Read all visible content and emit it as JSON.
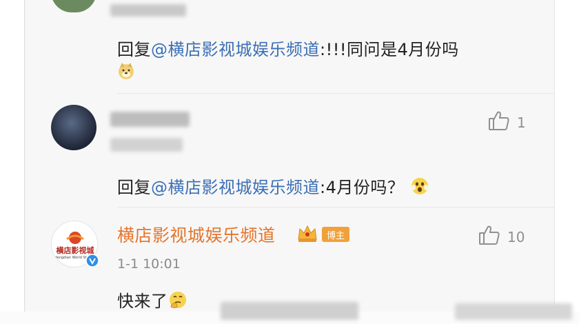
{
  "reply1": {
    "prefix": "回复",
    "mention": "@横店影视城娱乐频道",
    "suffix": ":!!!同问是4月份吗"
  },
  "comment2": {
    "like_count": "1",
    "reply_prefix": "回复",
    "reply_mention": "@横店影视城娱乐频道",
    "reply_suffix": ":4月份吗？"
  },
  "comment3": {
    "username": "横店影视城娱乐频道",
    "badge": "博主",
    "like_count": "10",
    "time": "1-1 10:01",
    "text": "快来了",
    "avatar_text": "横店影视城",
    "avatar_subtext": "Hengdian World Studios"
  },
  "icons": {
    "like": "thumbs-up-icon",
    "doge": "doge-emoji-icon",
    "shocked": "shocked-emoji-icon",
    "thinking": "thinking-emoji-icon",
    "crown": "crown-vip-icon",
    "verified": "verified-v-icon"
  },
  "colors": {
    "mention": "#3b6fb6",
    "username": "#e4752c",
    "badge": "#f0a13a"
  }
}
